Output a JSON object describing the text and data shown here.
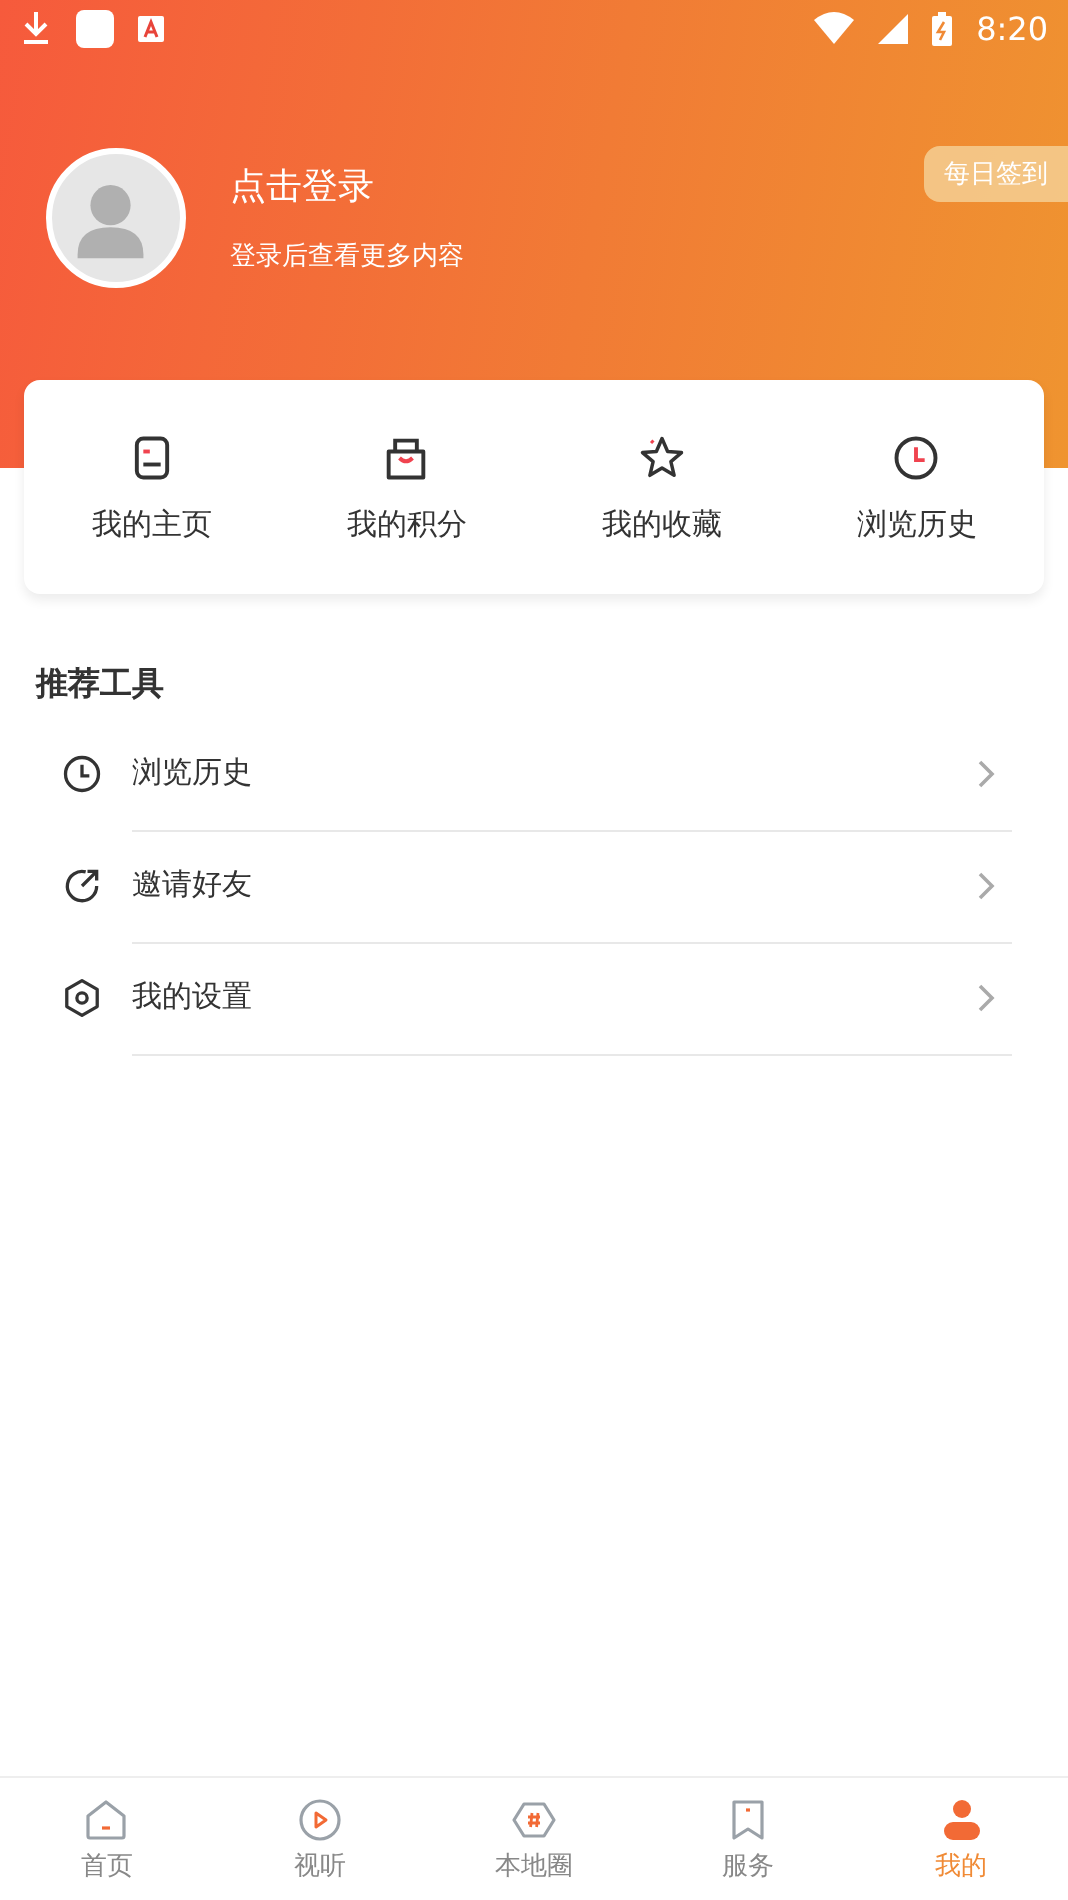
{
  "status_bar": {
    "time": "8:20"
  },
  "profile": {
    "title": "点击登录",
    "subtitle": "登录后查看更多内容",
    "checkin": "每日签到"
  },
  "shortcuts": [
    {
      "kind": "homepage",
      "label": "我的主页"
    },
    {
      "kind": "bag",
      "label": "我的积分"
    },
    {
      "kind": "star",
      "label": "我的收藏"
    },
    {
      "kind": "clock",
      "label": "浏览历史"
    }
  ],
  "tools": {
    "title": "推荐工具",
    "items": [
      {
        "kind": "clock",
        "label": "浏览历史"
      },
      {
        "kind": "share",
        "label": "邀请好友"
      },
      {
        "kind": "settings",
        "label": "我的设置"
      }
    ]
  },
  "bottom_nav": [
    {
      "kind": "home",
      "label": "首页",
      "selected": false
    },
    {
      "kind": "play",
      "label": "视听",
      "selected": false
    },
    {
      "kind": "hashtag",
      "label": "本地圈",
      "selected": false
    },
    {
      "kind": "bookmark",
      "label": "服务",
      "selected": false
    },
    {
      "kind": "person",
      "label": "我的",
      "selected": true
    }
  ]
}
